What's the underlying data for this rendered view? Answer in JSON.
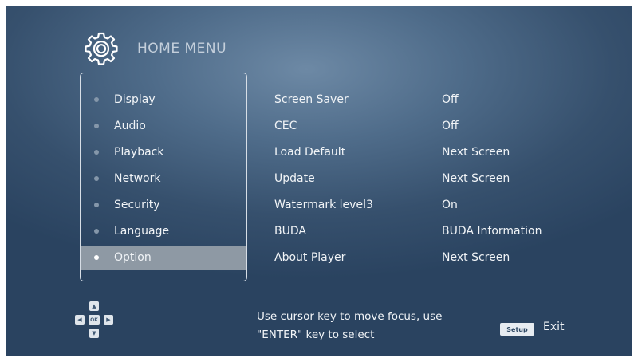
{
  "header": {
    "title": "HOME MENU",
    "icon": "gear-icon"
  },
  "sidebar": {
    "items": [
      {
        "label": "Display"
      },
      {
        "label": "Audio"
      },
      {
        "label": "Playback"
      },
      {
        "label": "Network"
      },
      {
        "label": "Security"
      },
      {
        "label": "Language"
      },
      {
        "label": "Option",
        "selected": true
      }
    ]
  },
  "options": [
    {
      "name": "Screen Saver",
      "value": "Off"
    },
    {
      "name": "CEC",
      "value": "Off"
    },
    {
      "name": "Load Default",
      "value": "Next Screen"
    },
    {
      "name": "Update",
      "value": "Next Screen"
    },
    {
      "name": "Watermark level3",
      "value": "On"
    },
    {
      "name": "BUDA",
      "value": "BUDA Information"
    },
    {
      "name": "About Player",
      "value": "Next Screen"
    }
  ],
  "footer": {
    "dpad_ok": "OK",
    "help_line1": "Use cursor key to move focus, use",
    "help_line2": "\"ENTER\" key to select",
    "setup_key": "Setup",
    "exit_label": "Exit"
  },
  "colors": {
    "background": "#4f6c8a",
    "selected_row": "#8e99a4",
    "text": "#f1f4f7"
  }
}
